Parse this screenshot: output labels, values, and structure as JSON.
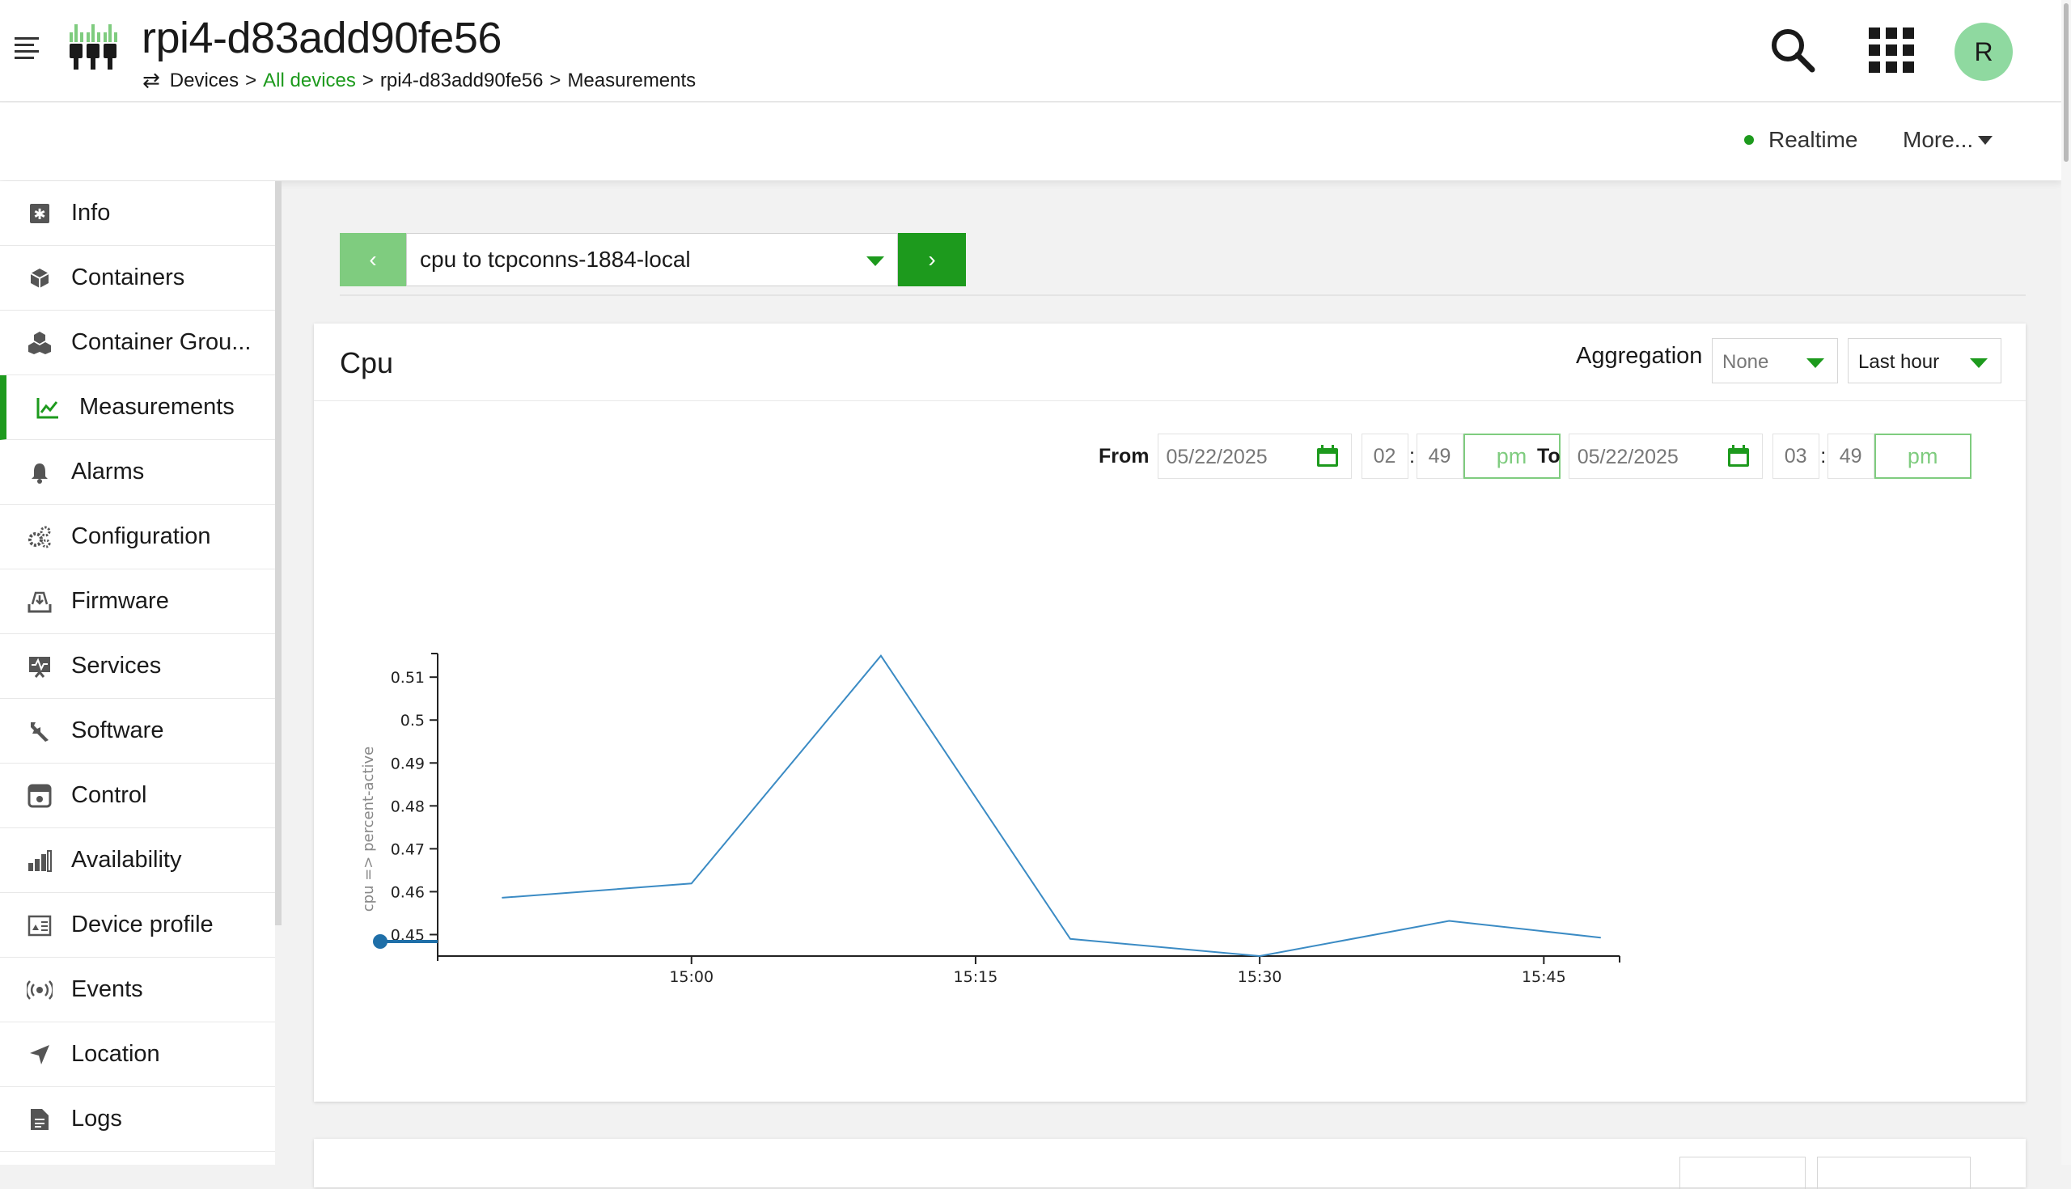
{
  "header": {
    "device_name": "rpi4-d83add90fe56",
    "breadcrumb": {
      "root": "Devices",
      "sep1": ">",
      "all_devices": "All devices",
      "sep2": ">",
      "device": "rpi4-d83add90fe56",
      "sep3": ">",
      "current": "Measurements"
    },
    "avatar_initial": "R"
  },
  "subbar": {
    "realtime_label": "Realtime",
    "more_label": "More..."
  },
  "sidebar": {
    "items": [
      {
        "label": "Info",
        "icon": "info-icon"
      },
      {
        "label": "Containers",
        "icon": "cube-icon"
      },
      {
        "label": "Container Grou...",
        "icon": "cubes-icon"
      },
      {
        "label": "Measurements",
        "icon": "line-chart-icon",
        "active": true
      },
      {
        "label": "Alarms",
        "icon": "bell-icon"
      },
      {
        "label": "Configuration",
        "icon": "gears-icon"
      },
      {
        "label": "Firmware",
        "icon": "download-tray-icon"
      },
      {
        "label": "Services",
        "icon": "monitor-pulse-icon"
      },
      {
        "label": "Software",
        "icon": "wrench-icon"
      },
      {
        "label": "Control",
        "icon": "control-panel-icon"
      },
      {
        "label": "Availability",
        "icon": "bar-chart-icon"
      },
      {
        "label": "Device profile",
        "icon": "profile-icon"
      },
      {
        "label": "Events",
        "icon": "broadcast-icon"
      },
      {
        "label": "Location",
        "icon": "location-arrow-icon"
      },
      {
        "label": "Logs",
        "icon": "document-icon"
      }
    ]
  },
  "selector": {
    "prev_label": "‹",
    "current": "cpu to tcpconns-1884-local",
    "next_label": "›"
  },
  "card": {
    "title": "Cpu",
    "aggregation_label": "Aggregation",
    "aggregation_value": "None",
    "interval_value": "Last hour",
    "from_label": "From",
    "from_date": "05/22/2025",
    "from_hour": "02",
    "from_minute": "49",
    "from_ampm": "pm",
    "to_label": "To",
    "to_date": "05/22/2025",
    "to_hour": "03",
    "to_minute": "49",
    "to_ampm": "pm",
    "time_sep": ":"
  },
  "colors": {
    "accent": "#1d9a1d",
    "accent_light": "#7fcc7f",
    "line": "#3b8bc4"
  },
  "chart_data": {
    "type": "line",
    "title": "",
    "xlabel": "",
    "ylabel": "cpu => percent-active",
    "x": [
      "14:50",
      "15:00",
      "15:10",
      "15:20",
      "15:30",
      "15:40",
      "15:48"
    ],
    "values": [
      0.4586,
      0.4619,
      0.515,
      0.449,
      0.445,
      0.4532,
      0.4493
    ],
    "xticks": [
      "15:00",
      "15:15",
      "15:30",
      "15:45"
    ],
    "yticks": [
      0.45,
      0.46,
      0.47,
      0.48,
      0.49,
      0.5,
      0.51
    ],
    "ylim": [
      0.445,
      0.5155
    ],
    "series": [
      {
        "name": "",
        "values": [
          0.4586,
          0.4619,
          0.515,
          0.449,
          0.445,
          0.4532,
          0.4493
        ]
      }
    ],
    "grid": false
  }
}
